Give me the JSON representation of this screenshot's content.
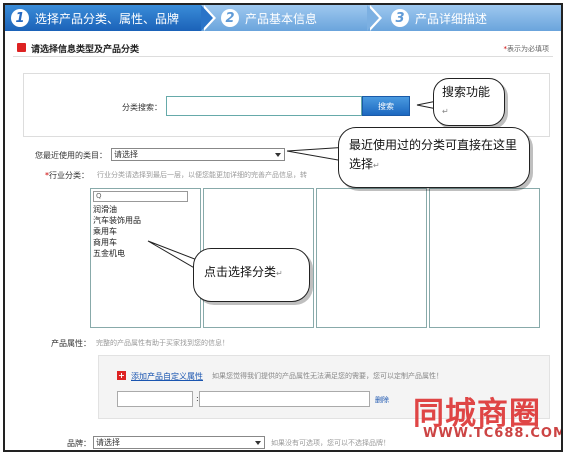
{
  "steps": [
    {
      "num": "1",
      "label": "选择产品分类、属性、品牌"
    },
    {
      "num": "2",
      "label": "产品基本信息"
    },
    {
      "num": "3",
      "label": "产品详细描述"
    }
  ],
  "section": {
    "title": "请选择信息类型及产品分类",
    "required_note_star": "*",
    "required_note": "表示为必填项"
  },
  "search": {
    "label": "分类搜索：",
    "input_value": "",
    "button_label": "搜索"
  },
  "recent": {
    "label": "您最近使用的类目：",
    "selected": "请选择"
  },
  "industry": {
    "star": "*",
    "label": "行业分类：",
    "hint": "行业分类请选择到最后一层，以便您能更加详细的完善产品信息，转",
    "filter_placeholder": "Q",
    "items": [
      "润滑油",
      "汽车装饰用品",
      "乘用车",
      "商用车",
      "五金机电"
    ]
  },
  "attributes": {
    "label": "产品属性：",
    "hint": "完整的产品属性有助于买家找到您的信息！",
    "add_custom_icon": "+",
    "add_custom_link": "添加产品自定义属性",
    "add_custom_hint": "如果您觉得我们提供的产品属性无法满足您的需要，您可以定制产品属性！",
    "colon": ":",
    "delete_label": "删除"
  },
  "brand": {
    "label": "品牌：",
    "selected": "请选择",
    "hint": "如果没有可选项，您可以不选择品牌！"
  },
  "callouts": {
    "search_tip": "搜索功能",
    "recent_tip": "最近使用过的分类可直接在这里选择",
    "click_tip": "点击选择分类",
    "return_mark": "↵"
  },
  "watermark": {
    "text": "同城商圈",
    "url": "WWW.TC688.COM"
  },
  "colors": {
    "step_active": "#1b62b8",
    "step_inactive": "#6aa4dc",
    "accent_red": "#dd2222",
    "link_blue": "#1a55b0"
  }
}
